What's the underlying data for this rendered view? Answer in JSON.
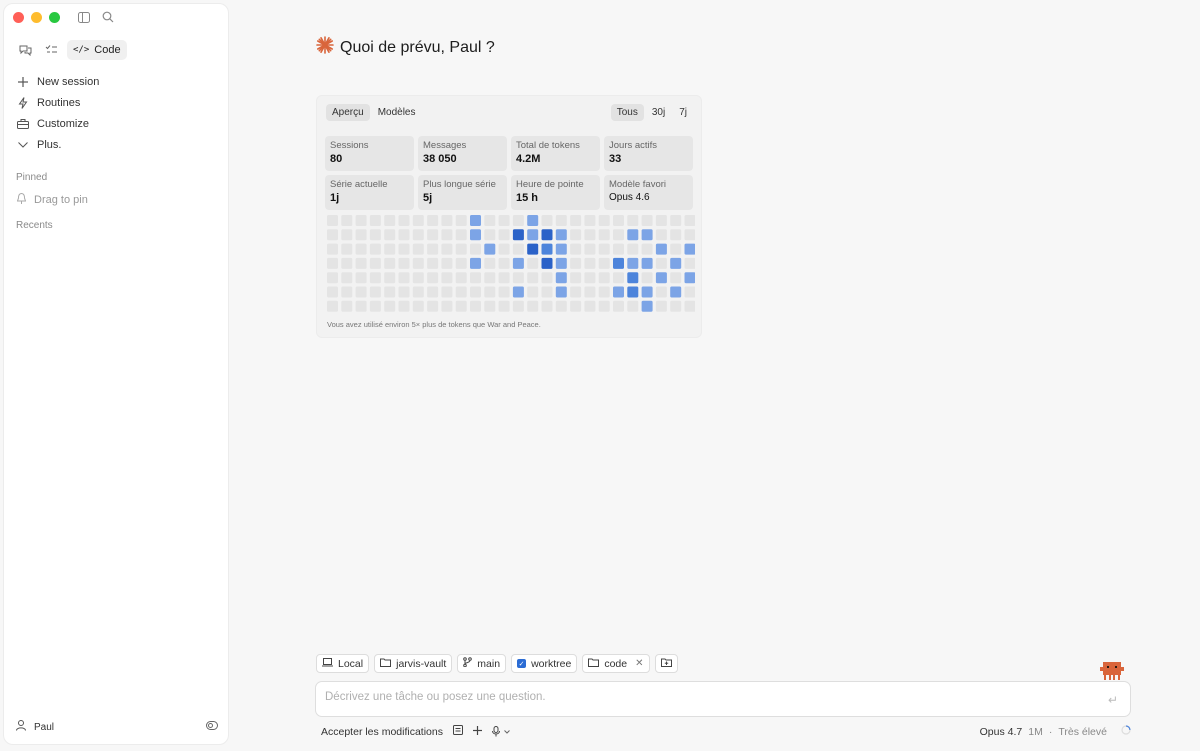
{
  "sidebar": {
    "mode_code_label": "Code",
    "nav": [
      {
        "label": "New session",
        "icon": "plus-icon"
      },
      {
        "label": "Routines",
        "icon": "lightning-icon"
      },
      {
        "label": "Customize",
        "icon": "briefcase-icon"
      },
      {
        "label": "Plus.",
        "icon": "chevron-down-icon"
      }
    ],
    "pinned_label": "Pinned",
    "drag_to_pin": "Drag to pin",
    "recents_label": "Recents",
    "user_name": "Paul"
  },
  "main": {
    "greeting": "Quoi de prévu, Paul ?",
    "accent_color": "#d9653b",
    "tabs": [
      "Aperçu",
      "Modèles"
    ],
    "range_tabs": [
      "Tous",
      "30j",
      "7j"
    ],
    "stats": [
      {
        "label": "Sessions",
        "value": "80"
      },
      {
        "label": "Messages",
        "value": "38 050"
      },
      {
        "label": "Total de tokens",
        "value": "4.2M"
      },
      {
        "label": "Jours actifs",
        "value": "33"
      },
      {
        "label": "Série actuelle",
        "value": "1j"
      },
      {
        "label": "Plus longue série",
        "value": "5j"
      },
      {
        "label": "Heure de pointe",
        "value": "15 h"
      },
      {
        "label": "Modèle favori",
        "value": "Opus 4.6"
      }
    ],
    "heatmap": {
      "colors": [
        "#e4e4e4",
        "#a7c2ee",
        "#7ca4e6",
        "#4d84db",
        "#2b62c8"
      ],
      "levels": [
        [
          0,
          0,
          0,
          0,
          0,
          0,
          0,
          0,
          0,
          0,
          2,
          0,
          0,
          0,
          2,
          0,
          0,
          0,
          0,
          0,
          0,
          0,
          0,
          0,
          0,
          0
        ],
        [
          0,
          0,
          0,
          0,
          0,
          0,
          0,
          0,
          0,
          0,
          2,
          0,
          0,
          4,
          2,
          4,
          2,
          0,
          0,
          0,
          0,
          2,
          2,
          0,
          0,
          0
        ],
        [
          0,
          0,
          0,
          0,
          0,
          0,
          0,
          0,
          0,
          0,
          0,
          2,
          0,
          0,
          4,
          3,
          2,
          0,
          0,
          0,
          0,
          0,
          0,
          2,
          0,
          2
        ],
        [
          0,
          0,
          0,
          0,
          0,
          0,
          0,
          0,
          0,
          0,
          2,
          0,
          0,
          2,
          0,
          4,
          2,
          0,
          0,
          0,
          3,
          2,
          2,
          0,
          2,
          0
        ],
        [
          0,
          0,
          0,
          0,
          0,
          0,
          0,
          0,
          0,
          0,
          0,
          0,
          0,
          0,
          0,
          0,
          2,
          0,
          0,
          0,
          0,
          3,
          0,
          2,
          0,
          2
        ],
        [
          0,
          0,
          0,
          0,
          0,
          0,
          0,
          0,
          0,
          0,
          0,
          0,
          0,
          2,
          0,
          0,
          2,
          0,
          0,
          0,
          2,
          3,
          2,
          0,
          2,
          0
        ],
        [
          0,
          0,
          0,
          0,
          0,
          0,
          0,
          0,
          0,
          0,
          0,
          0,
          0,
          0,
          0,
          0,
          0,
          0,
          0,
          0,
          0,
          0,
          2,
          0,
          0,
          0
        ]
      ]
    },
    "footnote": "Vous avez utilisé environ 5× plus de tokens que War and Peace."
  },
  "composer": {
    "chips": {
      "local": "Local",
      "folder": "jarvis-vault",
      "branch": "main",
      "worktree": "worktree",
      "code_folder": "code"
    },
    "placeholder": "Décrivez une tâche ou posez une question.",
    "accept_label": "Accepter les modifications",
    "model": "Opus 4.7",
    "context": "1M",
    "effort": "Très élevé"
  }
}
